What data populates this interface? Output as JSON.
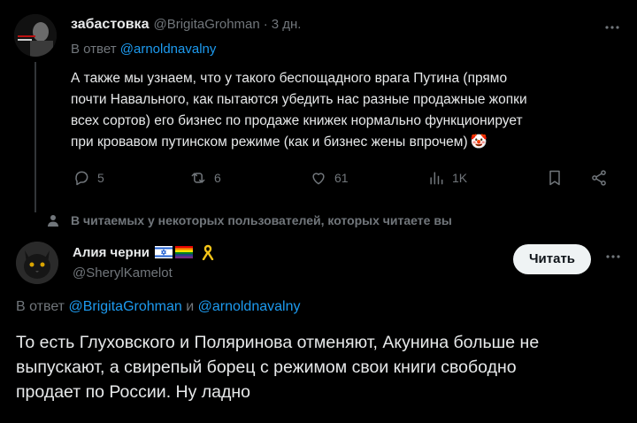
{
  "tweet1": {
    "display_name": "забастовка",
    "handle": "@BrigitaGrohman",
    "separator": "·",
    "time": "3 дн.",
    "reply_prefix": "В ответ",
    "reply_to": "@arnoldnavalny",
    "text_lines": [
      "А также мы узнаем, что у такого беспощадного  врага Путина (прямо",
      "почти Навального, как пытаются убедить нас разные продажные жопки",
      "всех сортов) его бизнес по продаже книжек нормально функционирует",
      "при кровавом путинском режиме (как и бизнес жены впрочем)"
    ],
    "emoji": "🤡",
    "actions": {
      "replies": "5",
      "reposts": "6",
      "likes": "61",
      "views": "1K"
    }
  },
  "section_note": "В читаемых у некоторых пользователей, которых читаете вы",
  "tweet2": {
    "display_name": "Алия черни",
    "handle": "@SherylKamelot",
    "follow_label": "Читать",
    "reply_prefix": "В ответ",
    "reply_to_1": "@BrigitaGrohman",
    "reply_and": "и",
    "reply_to_2": "@arnoldnavalny",
    "text_lines": [
      "То есть Глуховского и Поляринова отменяют, Акунина больше не",
      "выпускают, а свирепый борец с режимом свои книги свободно",
      "продает по России. Ну ладно"
    ]
  },
  "colors": {
    "background": "#000000",
    "text": "#e7e9ea",
    "muted": "#71767b",
    "link": "#1d9bf0",
    "button_bg": "#eff3f4"
  },
  "icons": [
    "reply-icon",
    "repost-icon",
    "like-icon",
    "views-icon",
    "bookmark-icon",
    "share-icon",
    "more-icon",
    "people-icon",
    "israel-flag-icon",
    "rainbow-flag-icon",
    "yellow-ribbon-icon"
  ]
}
